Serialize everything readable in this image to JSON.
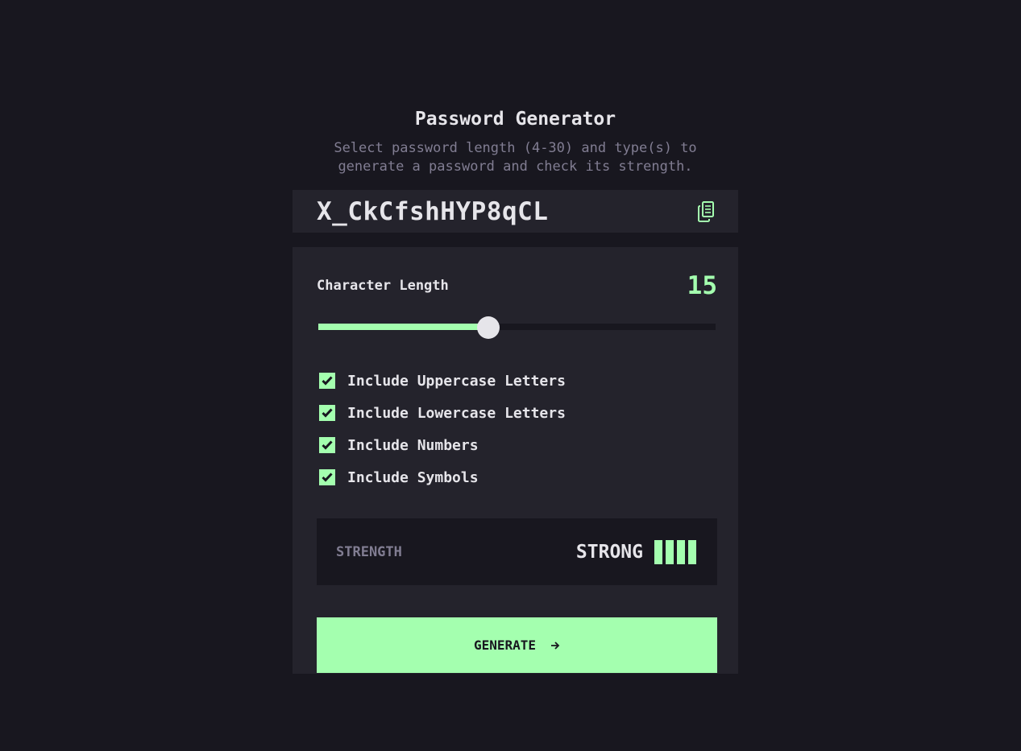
{
  "header": {
    "title": "Password Generator",
    "subtitle": "Select password length (4-30) and type(s) to generate a password and check its strength."
  },
  "password": {
    "value": "X_CkCfshHYP8qCL",
    "copy_icon": "copy-icon"
  },
  "length": {
    "label": "Character Length",
    "value": "15",
    "min": 4,
    "max": 30
  },
  "options": [
    {
      "label": "Include Uppercase Letters",
      "checked": true
    },
    {
      "label": "Include Lowercase Letters",
      "checked": true
    },
    {
      "label": "Include Numbers",
      "checked": true
    },
    {
      "label": "Include Symbols",
      "checked": true
    }
  ],
  "strength": {
    "label": "STRENGTH",
    "value": "STRONG",
    "bars_filled": 4,
    "bars_total": 4
  },
  "generate": {
    "label": "GENERATE",
    "icon": "arrow-right-icon"
  },
  "colors": {
    "background": "#18171f",
    "panel": "#24232c",
    "accent": "#a4ffaf",
    "text": "#e6e5ea",
    "muted": "#817d92"
  }
}
